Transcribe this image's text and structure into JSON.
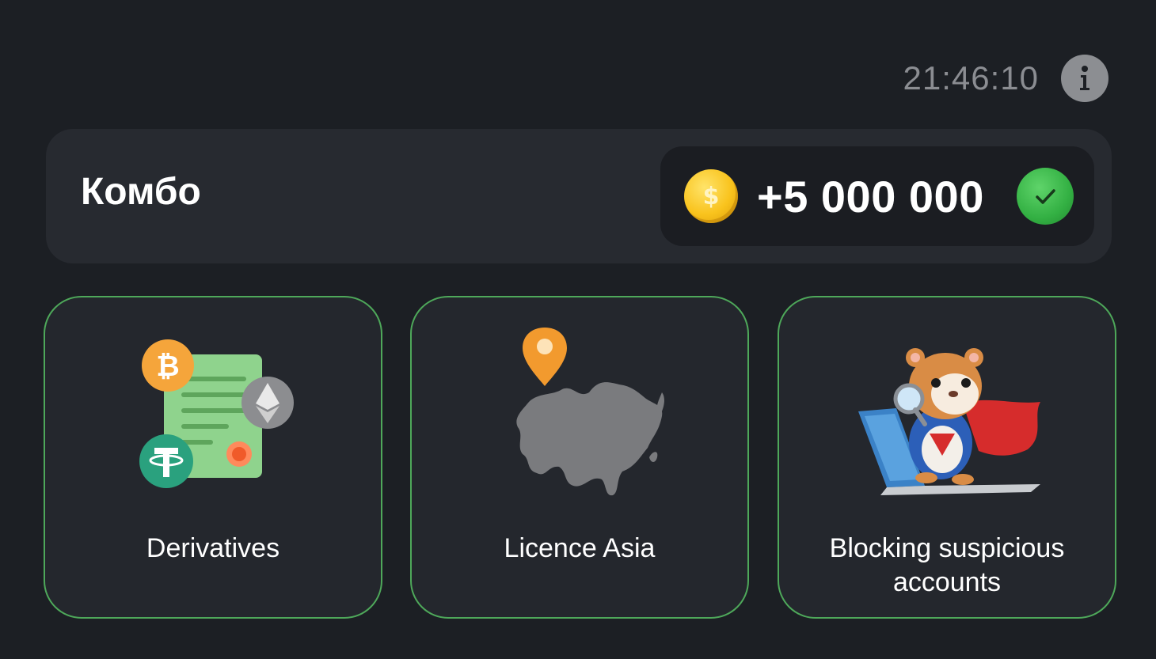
{
  "header": {
    "timer": "21:46:10",
    "info_icon": "info-icon"
  },
  "combo": {
    "title": "Комбо",
    "coin_icon": "gold-dollar-coin-icon",
    "reward": "+5 000 000",
    "status_icon": "green-check-icon",
    "completed": true
  },
  "cards": [
    {
      "label": "Derivatives",
      "icon": "crypto-document-icon",
      "found": true
    },
    {
      "label": "Licence Asia",
      "icon": "asia-map-pin-icon",
      "found": true
    },
    {
      "label": "Blocking suspicious accounts",
      "icon": "hamster-detective-laptop-icon",
      "found": true
    }
  ],
  "colors": {
    "background": "#1c1f24",
    "panel": "#272a30",
    "card_border": "#4ea85a",
    "coin": "#f9c31d",
    "check": "#33b043",
    "timer_text": "#8b8d92"
  }
}
